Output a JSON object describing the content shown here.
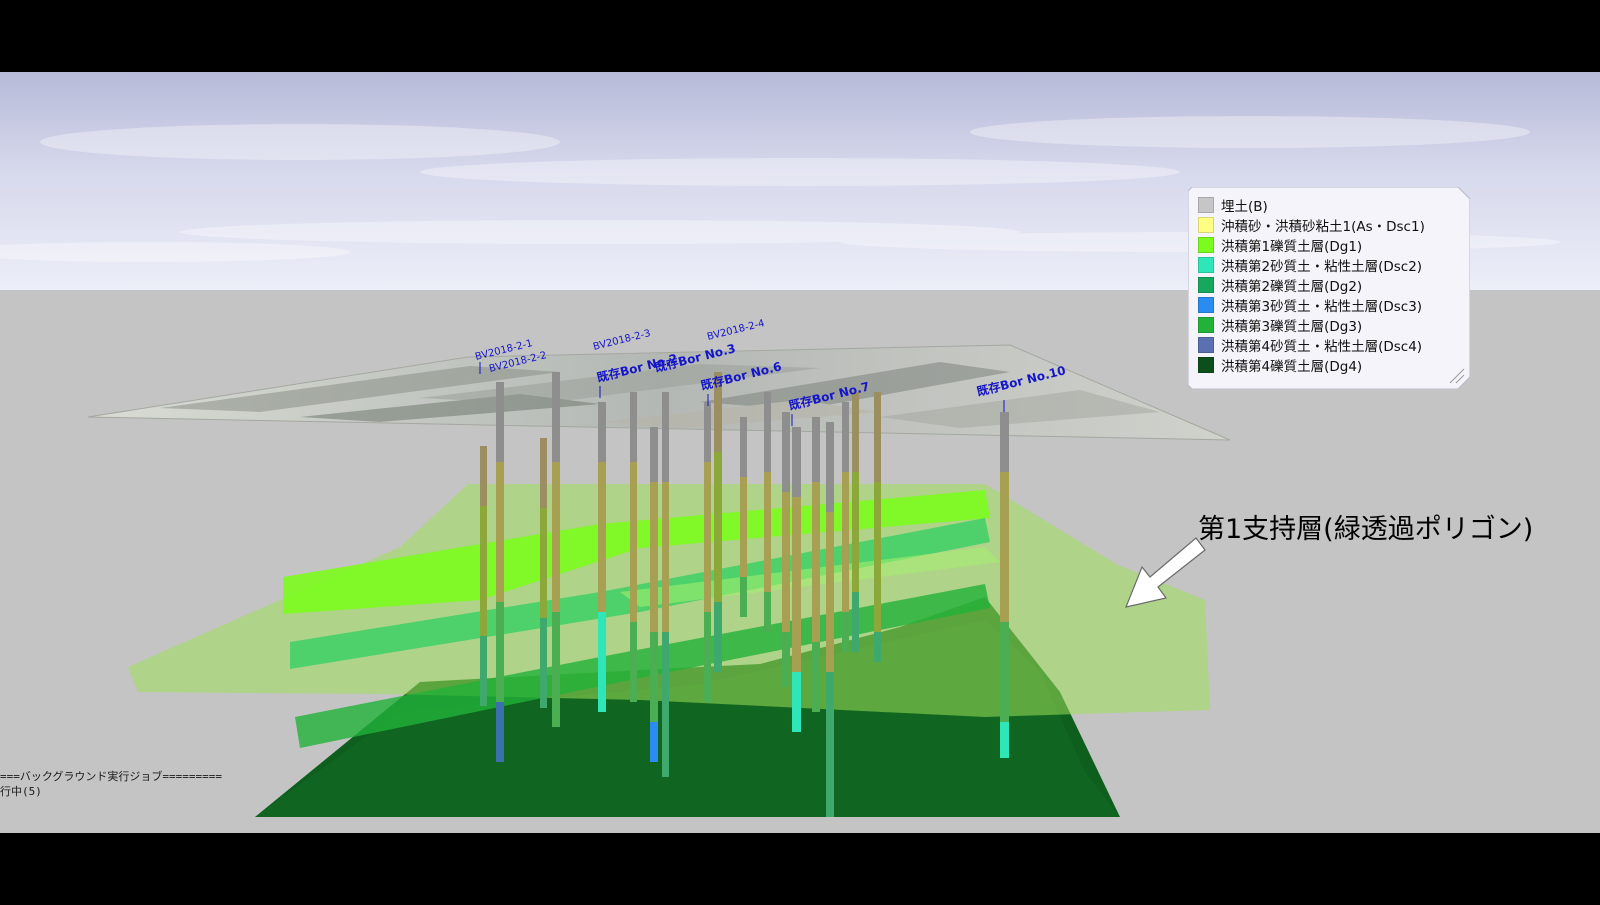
{
  "legend": {
    "items": [
      {
        "label": "埋土(B)",
        "color": "#c6c6c6"
      },
      {
        "label": "沖積砂・洪積砂粘土1(As・Dsc1)",
        "color": "#fefe82"
      },
      {
        "label": "洪積第1礫質土層(Dg1)",
        "color": "#7cfc1e"
      },
      {
        "label": "洪積第2砂質土・粘性土層(Dsc2)",
        "color": "#2ee6b8"
      },
      {
        "label": "洪積第2礫質土層(Dg2)",
        "color": "#16a85c"
      },
      {
        "label": "洪積第3砂質土・粘性土層(Dsc3)",
        "color": "#2a8cf0"
      },
      {
        "label": "洪積第3礫質土層(Dg3)",
        "color": "#22b23a"
      },
      {
        "label": "洪積第4砂質土・粘性土層(Dsc4)",
        "color": "#5a70b0"
      },
      {
        "label": "洪積第4礫質土層(Dg4)",
        "color": "#0c4f1a"
      }
    ]
  },
  "annotation": {
    "text": "第1支持層(緑透過ポリゴン)"
  },
  "boreholes": {
    "labels": [
      "BV2018-2-1",
      "BV2018-2-2",
      "BV2018-2-3",
      "BV2018-2-4",
      "既存Bor No.2",
      "既存Bor No.3",
      "既存Bor No.6",
      "既存Bor No.7",
      "既存Bor No.10"
    ]
  },
  "console": {
    "line1": "===バックグラウンド実行ジョブ=========",
    "line2": "行中(5)"
  },
  "colors": {
    "sky_top": "#b8bcd8",
    "ground": "#c4c4c4",
    "support_layer": "#9ce05a",
    "deep_layer": "#0e5e1e"
  }
}
